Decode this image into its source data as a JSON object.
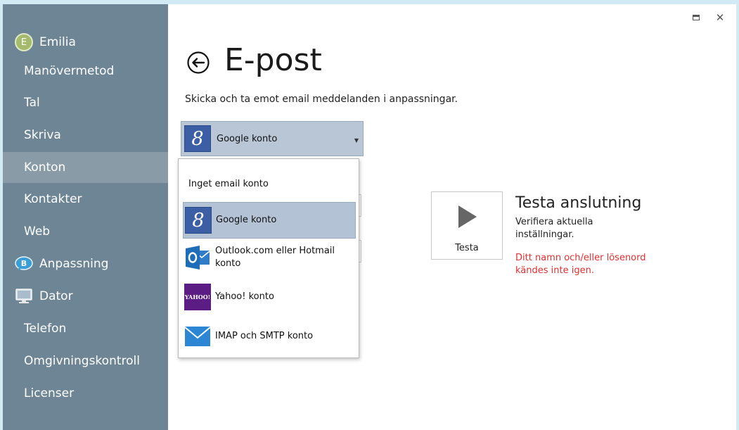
{
  "sidebar": {
    "user": {
      "initial": "E",
      "name": "Emilia"
    },
    "items": [
      {
        "label": "Manövermetod"
      },
      {
        "label": "Tal"
      },
      {
        "label": "Skriva"
      },
      {
        "label": "Konton"
      },
      {
        "label": "Kontakter"
      },
      {
        "label": "Web"
      },
      {
        "label": "Anpassning",
        "icon": "chat-bubble-icon"
      },
      {
        "label": "Dator",
        "icon": "monitor-icon"
      },
      {
        "label": "Telefon"
      },
      {
        "label": "Omgivningskontroll"
      },
      {
        "label": "Licenser"
      }
    ],
    "active": "Konton"
  },
  "window": {
    "maximize_icon": "maximize-icon",
    "close_icon": "close-icon",
    "close_glyph": "✕"
  },
  "header": {
    "title": "E-post",
    "subtitle": "Skicka och ta emot email meddelanden i anpassningar."
  },
  "account_select": {
    "selected": "Google konto",
    "logo_letter": "8"
  },
  "dropdown": {
    "options": [
      {
        "label": "Inget email konto"
      },
      {
        "label": "Google konto"
      },
      {
        "label": "Outlook.com eller Hotmail konto"
      },
      {
        "label": "Yahoo! konto",
        "logo_text": "YAHOO!"
      },
      {
        "label": "IMAP och SMTP konto"
      }
    ]
  },
  "test": {
    "button_label": "Testa",
    "title": "Testa anslutning",
    "description": "Verifiera aktuella inställningar.",
    "error": "Ditt namn och/eller lösenord kändes inte igen."
  },
  "colors": {
    "sidebar": "#6e8595",
    "sidebar_active": "#8a9ba8",
    "error": "#e03030",
    "selected": "#b3c3d5"
  }
}
